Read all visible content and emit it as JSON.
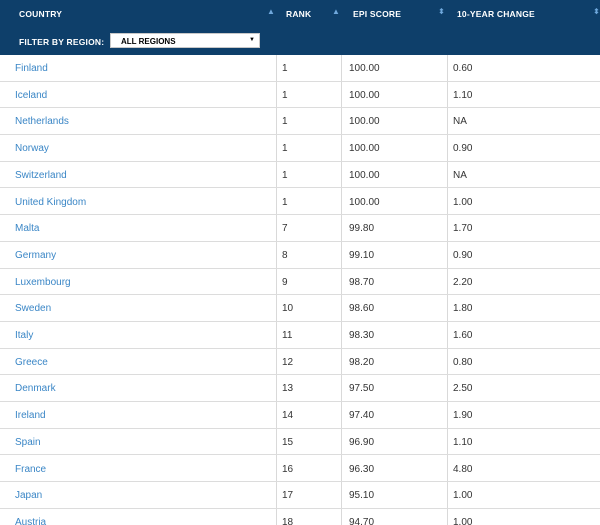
{
  "table": {
    "columns": [
      {
        "key": "country",
        "label": "COUNTRY"
      },
      {
        "key": "rank",
        "label": "RANK"
      },
      {
        "key": "score",
        "label": "EPI SCORE"
      },
      {
        "key": "change",
        "label": "10-YEAR CHANGE"
      }
    ],
    "filter": {
      "label": "FILTER BY REGION:",
      "selected": "ALL REGIONS"
    },
    "rows": [
      {
        "country": "Finland",
        "rank": "1",
        "score": "100.00",
        "change": "0.60"
      },
      {
        "country": "Iceland",
        "rank": "1",
        "score": "100.00",
        "change": "1.10"
      },
      {
        "country": "Netherlands",
        "rank": "1",
        "score": "100.00",
        "change": "NA"
      },
      {
        "country": "Norway",
        "rank": "1",
        "score": "100.00",
        "change": "0.90"
      },
      {
        "country": "Switzerland",
        "rank": "1",
        "score": "100.00",
        "change": "NA"
      },
      {
        "country": "United Kingdom",
        "rank": "1",
        "score": "100.00",
        "change": "1.00"
      },
      {
        "country": "Malta",
        "rank": "7",
        "score": "99.80",
        "change": "1.70"
      },
      {
        "country": "Germany",
        "rank": "8",
        "score": "99.10",
        "change": "0.90"
      },
      {
        "country": "Luxembourg",
        "rank": "9",
        "score": "98.70",
        "change": "2.20"
      },
      {
        "country": "Sweden",
        "rank": "10",
        "score": "98.60",
        "change": "1.80"
      },
      {
        "country": "Italy",
        "rank": "11",
        "score": "98.30",
        "change": "1.60"
      },
      {
        "country": "Greece",
        "rank": "12",
        "score": "98.20",
        "change": "0.80"
      },
      {
        "country": "Denmark",
        "rank": "13",
        "score": "97.50",
        "change": "2.50"
      },
      {
        "country": "Ireland",
        "rank": "14",
        "score": "97.40",
        "change": "1.90"
      },
      {
        "country": "Spain",
        "rank": "15",
        "score": "96.90",
        "change": "1.10"
      },
      {
        "country": "France",
        "rank": "16",
        "score": "96.30",
        "change": "4.80"
      },
      {
        "country": "Japan",
        "rank": "17",
        "score": "95.10",
        "change": "1.00"
      },
      {
        "country": "Austria",
        "rank": "18",
        "score": "94.70",
        "change": "1.00"
      }
    ]
  },
  "icons": {
    "sort_asc": "▲",
    "sort_both": "⬍",
    "dropdown": "▼"
  },
  "colors": {
    "header_bg": "#0e3f6a",
    "link": "#3a86c6",
    "sort_icon": "#6fa8dc"
  }
}
